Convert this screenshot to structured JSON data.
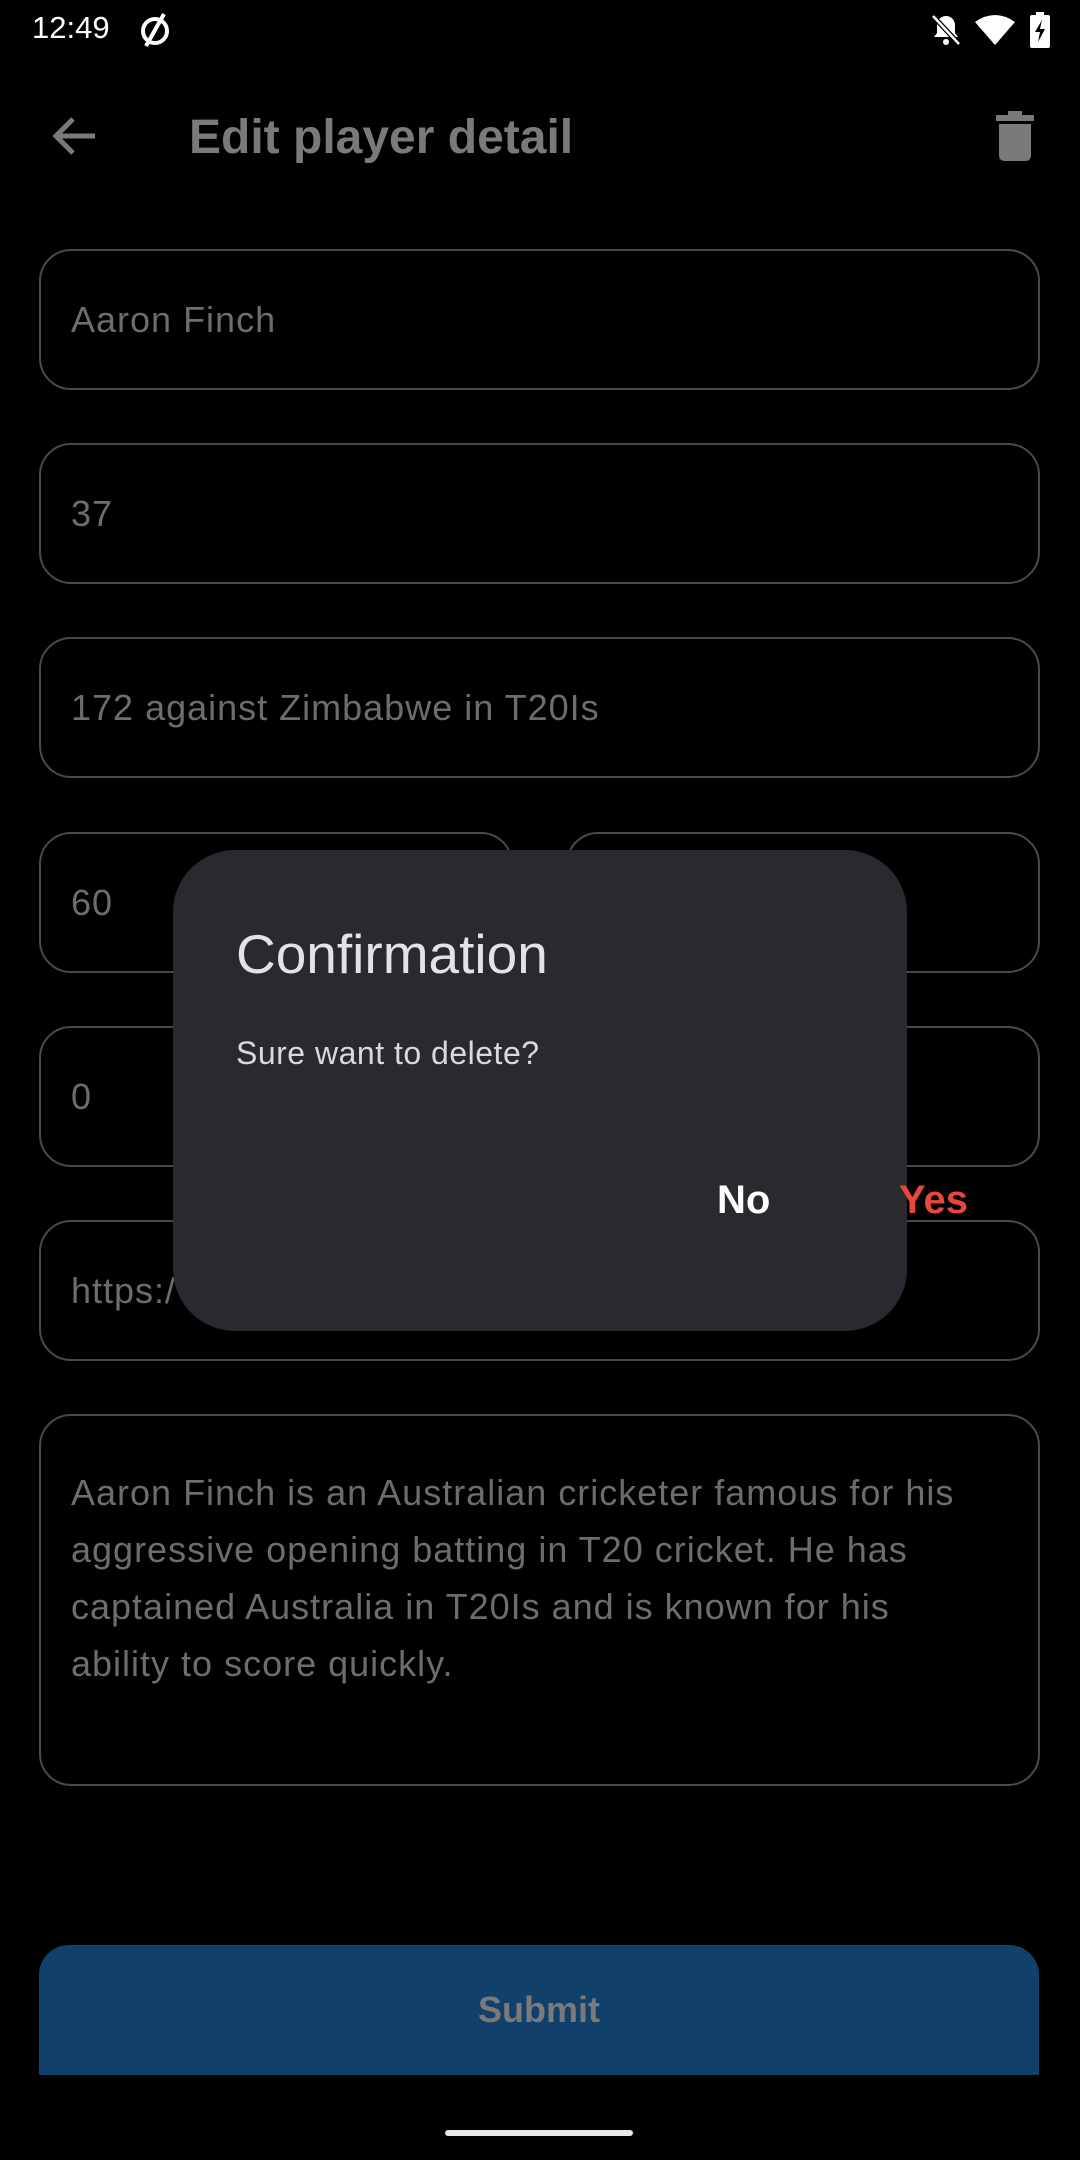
{
  "status_bar": {
    "time": "12:49"
  },
  "app_bar": {
    "title": "Edit player detail",
    "back_icon": "arrow-back-icon",
    "delete_icon": "trash-icon"
  },
  "form": {
    "name_value": "Aaron Finch",
    "age_value": "37",
    "best_score_value": "172 against Zimbabwe in T20Is",
    "field_a_value": "60",
    "field_b_value": "",
    "field_c_value": "0",
    "field_d_value": "",
    "url_value": "https:/",
    "description_value": "Aaron Finch is an Australian cricketer famous for his aggressive opening batting in T20 cricket. He has captained Australia in T20Is and is known for his ability to score quickly.",
    "submit_label": "Submit"
  },
  "dialog": {
    "title": "Confirmation",
    "message": "Sure want to delete?",
    "no_label": "No",
    "yes_label": "Yes"
  },
  "colors": {
    "background": "#000000",
    "dialog_surface": "#2b2930",
    "submit_button": "#11406a",
    "yes_accent": "#e8483b"
  }
}
